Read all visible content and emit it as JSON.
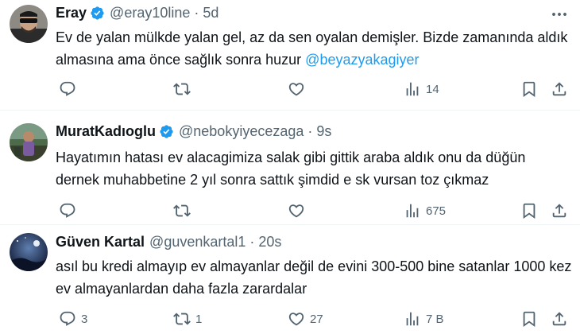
{
  "tweets": [
    {
      "name": "Eray",
      "handle": "@eray10line",
      "time": "5d",
      "text": "Ev de yalan mülkde yalan gel, az da sen oyalan demişler.  Bizde zamanında aldık almasına ama önce sağlık sonra huzur ",
      "mention": "@beyazyakagiyer",
      "verified": true,
      "replies": "",
      "retweets": "",
      "likes": "",
      "views": "14"
    },
    {
      "name": "MuratKadıoglu",
      "handle": "@nebokyiyecezaga",
      "time": "9s",
      "text": "Hayatımın hatası ev alacagimiza salak gibi gittik araba aldık onu da düğün dernek muhabbetine 2 yıl sonra sattık şimdid e sk vursan toz çıkmaz",
      "verified": true,
      "replies": "",
      "retweets": "",
      "likes": "",
      "views": "675"
    },
    {
      "name": "Güven Kartal",
      "handle": "@guvenkartal1",
      "time": "20s",
      "text": "asıl bu kredi almayıp ev almayanlar değil de evini 300-500 bine satanlar 1000 kez ev almayanlardan daha fazla zarardalar",
      "verified": false,
      "replies": "3",
      "retweets": "1",
      "likes": "27",
      "views": "7 B"
    }
  ],
  "separator_dot": "·",
  "colors": {
    "accent": "#1d9bf0",
    "muted": "#536471",
    "text": "#0f1419"
  },
  "icons": [
    "reply-icon",
    "retweet-icon",
    "like-icon",
    "views-icon",
    "bookmark-icon",
    "share-icon",
    "more-icon",
    "verified-badge-icon"
  ]
}
